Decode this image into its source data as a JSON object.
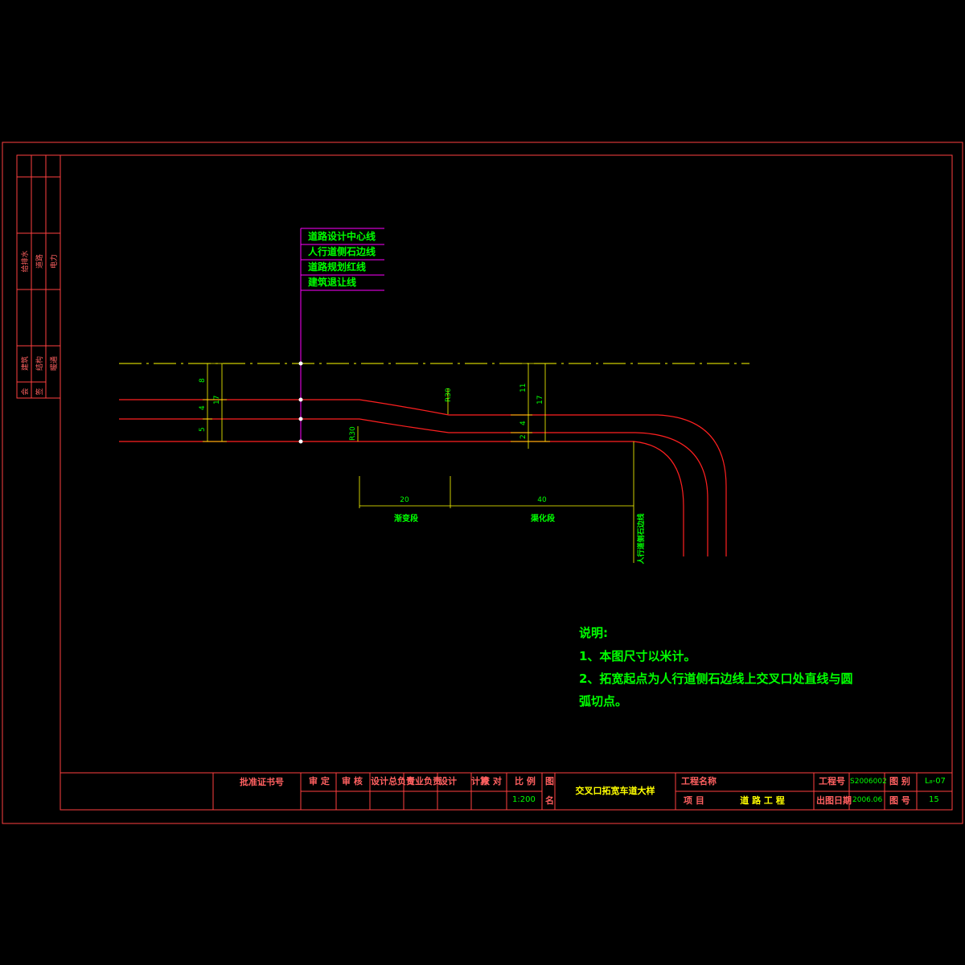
{
  "legend": [
    "道路设计中心线",
    "人行道侧石边线",
    "道路规划红线",
    "建筑退让线"
  ],
  "dimensions": {
    "left_8": "8",
    "left_4": "4",
    "left_5": "5",
    "left_17": "17",
    "right_11": "11",
    "right_4": "4",
    "right_2": "2",
    "right_17": "17",
    "radius_top": "R30",
    "radius_bottom": "R30",
    "length_20": "20",
    "length_40": "40",
    "label_transition": "渐变段",
    "label_channelized": "渠化段",
    "label_crossroad": "人行道侧石边线"
  },
  "notes": {
    "title": "说明:",
    "line1": "1、本图尺寸以米计。",
    "line2": "2、拓宽起点为人行道侧石边线上交叉口处直线与圆",
    "line3": "弧切点。"
  },
  "sidebar": {
    "col1": [
      "给排水",
      "建筑"
    ],
    "col2": [
      "道路",
      "结构"
    ],
    "col3": [
      "电力",
      "暖通"
    ],
    "bottom": [
      "会",
      "签"
    ]
  },
  "titleblock": {
    "approval": "批准证书号",
    "review": "审  定",
    "check": "审  核",
    "design_lead": "设计总负责",
    "specialty_lead": "专业负责",
    "designer": "设计",
    "calc": "计算",
    "proof": "校  对",
    "scale_label": "比  例",
    "scale_value": "1:200",
    "drawing_name_label1": "图",
    "drawing_name_label2": "名",
    "drawing_name": "交叉口拓宽车道大样",
    "project_name_label": "工程名称",
    "item_label": "项  目",
    "item_value": "道 路 工 程",
    "project_no_label": "工程号",
    "project_no": "S2006002",
    "date_label": "出图日期",
    "date_value": "2006.06",
    "category_label": "图  别",
    "category_value": "L₈-07",
    "drawing_no_label": "图  号",
    "drawing_no": "15"
  }
}
